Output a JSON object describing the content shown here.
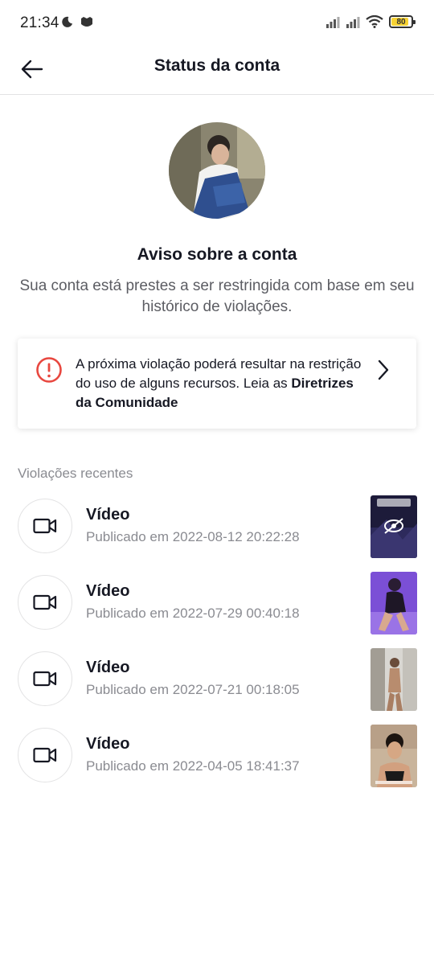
{
  "status_bar": {
    "time": "21:34",
    "battery": "80",
    "battery_level": 0.8,
    "icons": [
      "moon-icon",
      "notification-icon",
      "signal-icon",
      "signal-icon",
      "wifi-icon",
      "battery-icon"
    ]
  },
  "header": {
    "title": "Status da conta",
    "back_icon": "arrow-left-icon"
  },
  "hero": {
    "title": "Aviso sobre a conta",
    "description": "Sua conta está prestes a ser restringida com base em seu histórico de violações."
  },
  "warning": {
    "icon": "alert-circle-icon",
    "accent_color": "#e8473f",
    "text": "A próxima violação poderá resultar na restrição do uso de alguns recursos. Leia as ",
    "link": "Diretrizes da Comunidade"
  },
  "violations": {
    "label": "Violações recentes",
    "items": [
      {
        "title": "Vídeo",
        "date": "Publicado em 2022-08-12 20:22:28"
      },
      {
        "title": "Vídeo",
        "date": "Publicado em 2022-07-29 00:40:18"
      },
      {
        "title": "Vídeo",
        "date": "Publicado em 2022-07-21 00:18:05"
      },
      {
        "title": "Vídeo",
        "date": "Publicado em 2022-04-05 18:41:37"
      }
    ]
  }
}
